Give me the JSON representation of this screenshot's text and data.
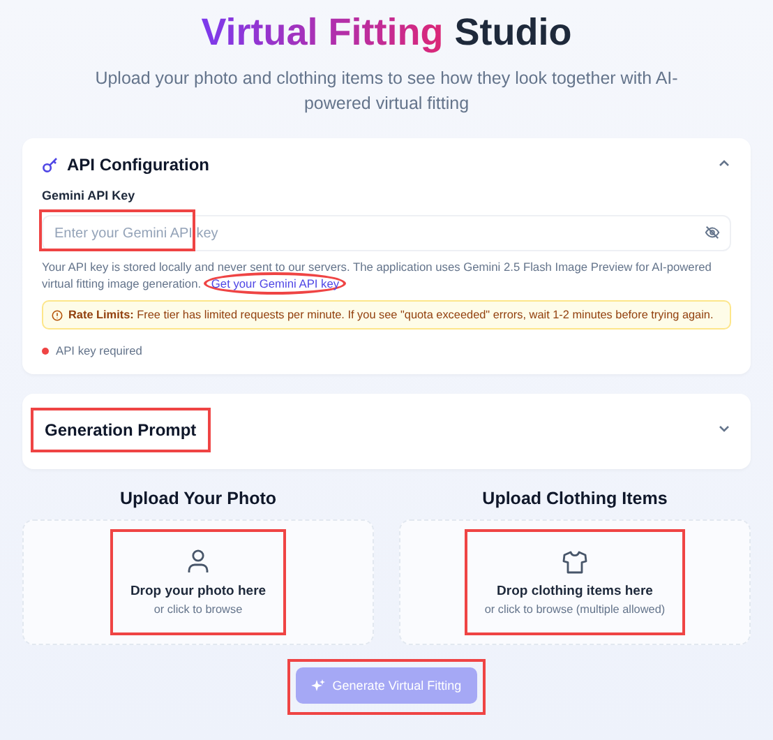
{
  "header": {
    "title_accent": "Virtual Fitting",
    "title_rest": "Studio",
    "subtitle": "Upload your photo and clothing items to see how they look together with AI-powered virtual fitting"
  },
  "api_config": {
    "title": "API Configuration",
    "expanded": true,
    "field_label": "Gemini API Key",
    "placeholder": "Enter your Gemini API key",
    "help_text": "Your API key is stored locally and never sent to our servers. The application uses Gemini 2.5 Flash Image Preview for AI-powered virtual fitting image generation.",
    "help_link": "Get your Gemini API key",
    "rate_limit_label": "Rate Limits:",
    "rate_limit_text": "Free tier has limited requests per minute. If you see \"quota exceeded\" errors, wait 1-2 minutes before trying again.",
    "status": {
      "text": "API key required",
      "color": "#ef4444"
    }
  },
  "generation_prompt": {
    "title": "Generation Prompt",
    "expanded": false
  },
  "uploads": [
    {
      "kind": "person",
      "heading": "Upload Your Photo",
      "drop_text": "Drop your photo here",
      "hint": "or click to browse"
    },
    {
      "kind": "shirt",
      "heading": "Upload Clothing Items",
      "drop_text": "Drop clothing items here",
      "hint": "or click to browse (multiple allowed)"
    }
  ],
  "generate_button": {
    "label": "Generate Virtual Fitting",
    "disabled": true
  }
}
